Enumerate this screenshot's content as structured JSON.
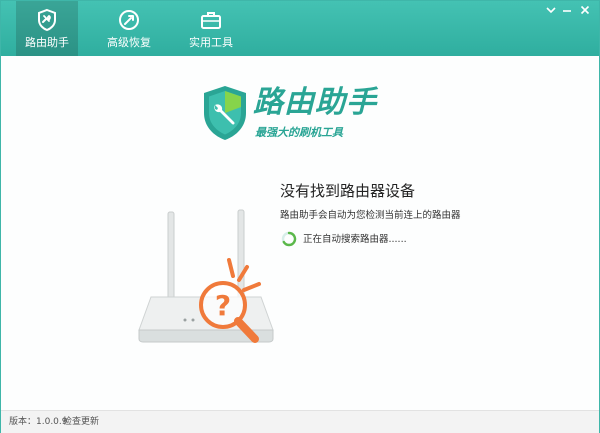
{
  "tabs": [
    {
      "label": "路由助手",
      "icon": "shield-wrench-icon",
      "active": true
    },
    {
      "label": "高级恢复",
      "icon": "restore-icon",
      "active": false
    },
    {
      "label": "实用工具",
      "icon": "toolbox-icon",
      "active": false
    }
  ],
  "window_controls": {
    "menu": "menu-icon",
    "minimize": "minimize-icon",
    "close": "close-icon"
  },
  "logo": {
    "title": "路由助手",
    "subtitle": "最强大的刷机工具"
  },
  "status": {
    "title": "没有找到路由器设备",
    "description": "路由助手会自动为您检测当前连上的路由器",
    "searching": "正在自动搜索路由器......"
  },
  "footer": {
    "version": "版本：1.0.0.9",
    "check_update": "检查更新"
  },
  "colors": {
    "accent": "#2fae9f",
    "orange": "#f07a3b"
  }
}
